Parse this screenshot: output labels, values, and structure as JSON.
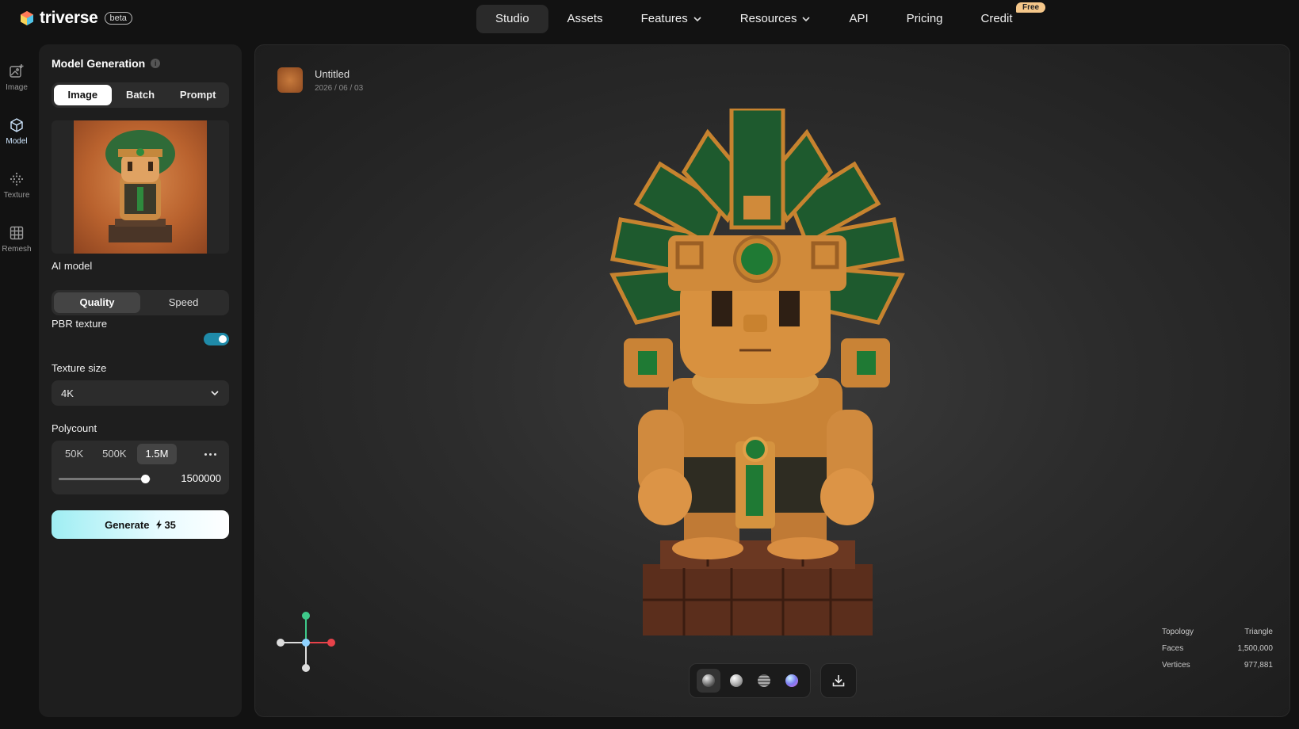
{
  "brand": {
    "name": "triverse",
    "badge": "beta"
  },
  "nav": {
    "items": [
      {
        "label": "Studio",
        "dropdown": false,
        "active": true
      },
      {
        "label": "Assets",
        "dropdown": false
      },
      {
        "label": "Features",
        "dropdown": true
      },
      {
        "label": "Resources",
        "dropdown": true
      },
      {
        "label": "API",
        "dropdown": false
      },
      {
        "label": "Pricing",
        "dropdown": false
      },
      {
        "label": "Credit",
        "dropdown": false
      }
    ],
    "credit_badge": "Free"
  },
  "rail": {
    "items": [
      {
        "label": "Image",
        "icon": "image-plus-icon"
      },
      {
        "label": "Model",
        "icon": "cube-icon",
        "active": true
      },
      {
        "label": "Texture",
        "icon": "texture-dots-icon"
      },
      {
        "label": "Remesh",
        "icon": "grid-icon"
      }
    ]
  },
  "panel": {
    "title": "Model Generation",
    "tabs": [
      "Image",
      "Batch",
      "Prompt"
    ],
    "active_tab": "Image",
    "ai_model_label": "AI model",
    "ai_model_options": [
      "Quality",
      "Speed"
    ],
    "ai_model_selected": "Quality",
    "pbr_label": "PBR texture",
    "pbr_on": true,
    "texture_size_label": "Texture size",
    "texture_size_value": "4K",
    "polycount_label": "Polycount",
    "polycount_options": [
      "50K",
      "500K",
      "1.5M"
    ],
    "polycount_selected": "1.5M",
    "polycount_value": "1500000",
    "polycount_slider_fraction": 0.94,
    "generate_label": "Generate",
    "generate_cost": "35"
  },
  "viewport": {
    "file_name": "Untitled",
    "file_date": "2026 / 06 / 03",
    "render_modes": [
      "solid-ball",
      "matte-ball",
      "wireframe-ball",
      "iridescent-ball"
    ],
    "stats": [
      {
        "label": "Topology",
        "value": "Triangle"
      },
      {
        "label": "Faces",
        "value": "1,500,000"
      },
      {
        "label": "Vertices",
        "value": "977,881"
      }
    ]
  },
  "colors": {
    "accent": "#1f8aa8",
    "generate_gradient_start": "#9feef3",
    "axis_x": "#e8424a",
    "axis_y": "#3ec98a"
  }
}
